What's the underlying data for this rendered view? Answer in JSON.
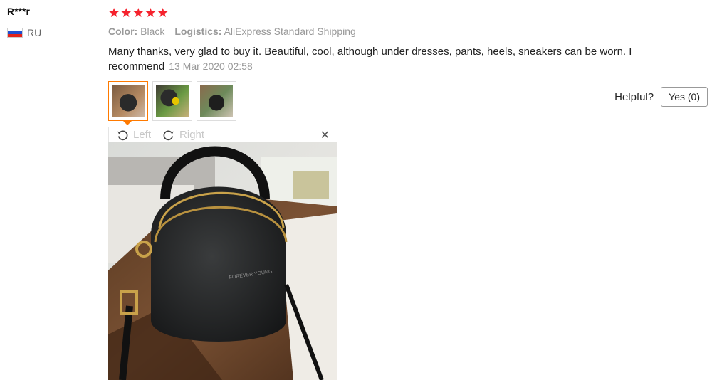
{
  "user": {
    "name": "R***r",
    "country_code": "RU"
  },
  "review": {
    "stars": 5,
    "color_key": "Color:",
    "color_value": "Black",
    "logistics_key": "Logistics:",
    "logistics_value": "AliExpress Standard Shipping",
    "text": "Many thanks, very glad to buy it. Beautiful, cool, although under dresses, pants, heels, sneakers can be worn. I recommend",
    "date": "13 Mar 2020 02:58"
  },
  "thumbnails": [
    {
      "icon": "bag-photo-1"
    },
    {
      "icon": "bag-photo-2"
    },
    {
      "icon": "bag-photo-3"
    }
  ],
  "helpful": {
    "label": "Helpful?",
    "yes_label": "Yes (0)"
  },
  "viewer": {
    "rotate_left_label": "Left",
    "rotate_right_label": "Right",
    "close_icon": "close-icon",
    "photo_brand_text": "FOREVER YOUNG"
  },
  "colors": {
    "star": "#f5222d",
    "active_thumb_border": "#ff7a00",
    "muted_text": "#999999"
  }
}
